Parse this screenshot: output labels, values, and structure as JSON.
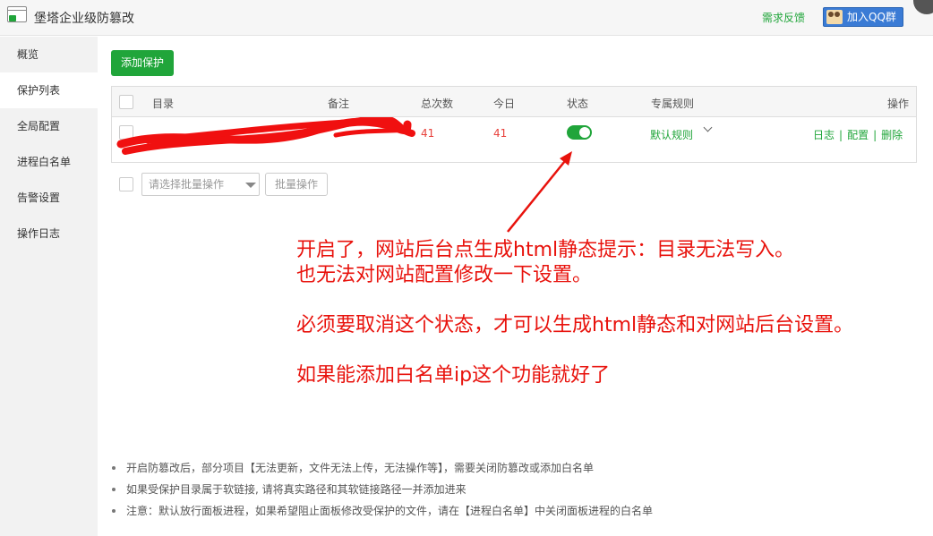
{
  "window": {
    "title": "堡塔企业级防篡改",
    "feedback_label": "需求反馈",
    "qq_label": "加入QQ群"
  },
  "sidebar": {
    "items": [
      {
        "label": "概览"
      },
      {
        "label": "保护列表",
        "active": true
      },
      {
        "label": "全局配置"
      },
      {
        "label": "进程白名单"
      },
      {
        "label": "告警设置"
      },
      {
        "label": "操作日志"
      }
    ]
  },
  "toolbar": {
    "add_label": "添加保护"
  },
  "table": {
    "columns": [
      "目录",
      "备注",
      "总次数",
      "今日",
      "状态",
      "专属规则",
      "操作"
    ],
    "rows": [
      {
        "total": "41",
        "today": "41",
        "status_on": true,
        "rule": "默认规则",
        "actions": [
          "日志",
          "配置",
          "删除"
        ]
      }
    ]
  },
  "bulk": {
    "select_placeholder": "请选择批量操作",
    "button_label": "批量操作"
  },
  "annotation": {
    "lines": [
      "开启了，网站后台点生成html静态提示：目录无法写入。",
      "也无法对网站配置修改一下设置。",
      "",
      "必须要取消这个状态，才可以生成html静态和对网站后台设置。",
      "",
      "如果能添加白名单ip这个功能就好了"
    ],
    "color": "#e8120c"
  },
  "tips": [
    "开启防篡改后，部分项目【无法更新，文件无法上传，无法操作等】，需要关闭防篡改或添加白名单",
    "如果受保护目录属于软链接, 请将真实路径和其软链接路径一并添加进来",
    "注意：默认放行面板进程，如果希望阻止面板修改受保护的文件，请在【进程白名单】中关闭面板进程的白名单"
  ],
  "colors": {
    "accent": "#20a53a",
    "danger": "#e8413b",
    "qq": "#3a7bd5"
  }
}
